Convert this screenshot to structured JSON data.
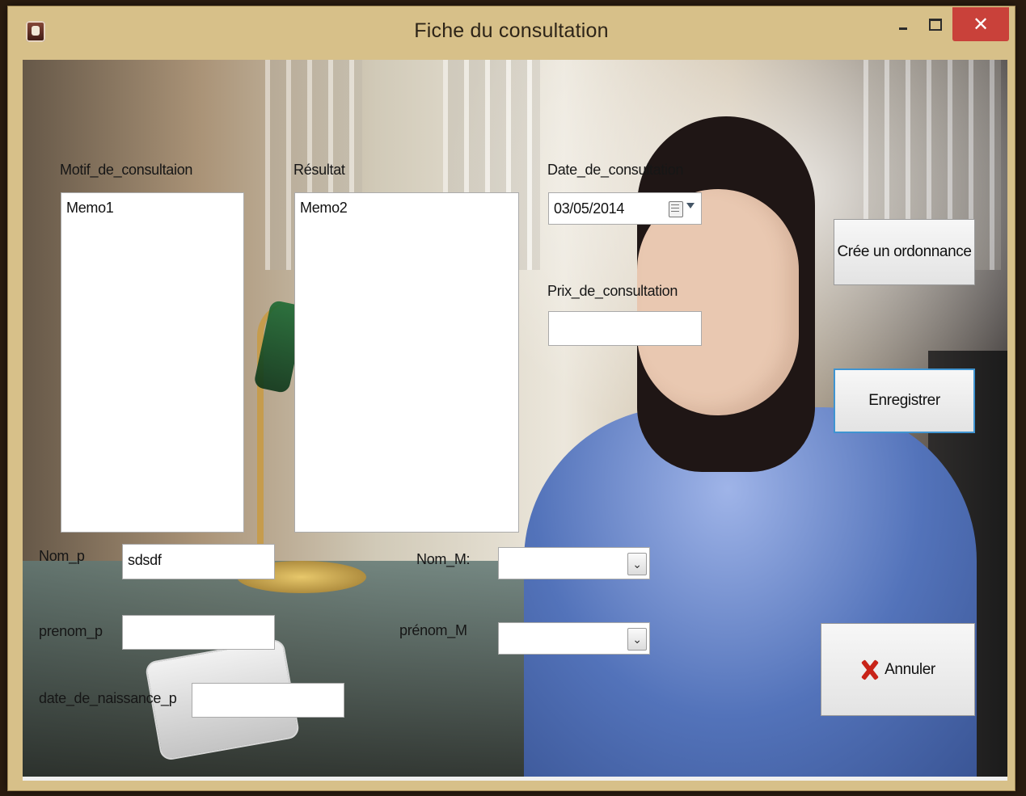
{
  "window": {
    "title": "Fiche du consultation",
    "minimize_label": "",
    "maximize_label": "",
    "close_label": "✕"
  },
  "form": {
    "motif_label": "Motif_de_consultaion",
    "motif_value": "Memo1",
    "resultat_label": "Résultat",
    "resultat_value": "Memo2",
    "date_label": "Date_de_consultation",
    "date_value": "03/05/2014",
    "prix_label": "Prix_de_consultation",
    "prix_value": "",
    "nom_p_label": "Nom_p",
    "nom_p_value": "sdsdf",
    "prenom_p_label": "prenom_p",
    "prenom_p_value": "",
    "date_naissance_label": "date_de_naissance_p",
    "date_naissance_value": "",
    "nom_m_label": "Nom_M:",
    "nom_m_value": "",
    "prenom_m_label": "prénom_M",
    "prenom_m_value": ""
  },
  "buttons": {
    "ordonnance": "Crée un ordonnance",
    "enregistrer": "Enregistrer",
    "annuler": "Annuler"
  }
}
